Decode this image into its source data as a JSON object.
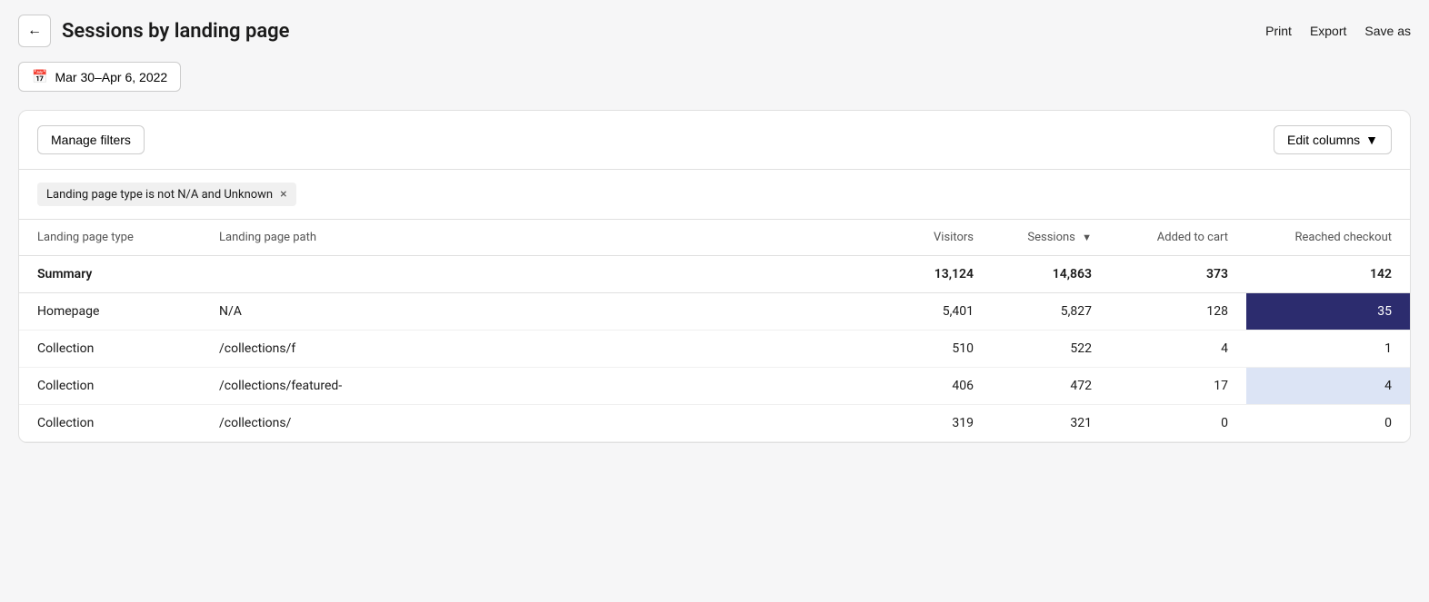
{
  "header": {
    "back_label": "←",
    "title": "Sessions by landing page",
    "actions": {
      "print": "Print",
      "export": "Export",
      "save_as": "Save as"
    }
  },
  "date_filter": {
    "label": "Mar 30–Apr 6, 2022"
  },
  "toolbar": {
    "manage_filters": "Manage filters",
    "edit_columns": "Edit columns"
  },
  "filter": {
    "tag": "Landing page type is not N/A and Unknown",
    "remove_label": "×"
  },
  "table": {
    "columns": [
      {
        "key": "landing_type",
        "label": "Landing page type",
        "numeric": false
      },
      {
        "key": "landing_path",
        "label": "Landing page path",
        "numeric": false
      },
      {
        "key": "visitors",
        "label": "Visitors",
        "numeric": true
      },
      {
        "key": "sessions",
        "label": "Sessions",
        "numeric": true,
        "sorted": true
      },
      {
        "key": "added_to_cart",
        "label": "Added to cart",
        "numeric": true
      },
      {
        "key": "reached_checkout",
        "label": "Reached checkout",
        "numeric": true
      }
    ],
    "summary": {
      "label": "Summary",
      "visitors": "13,124",
      "sessions": "14,863",
      "added_to_cart": "373",
      "reached_checkout": "142"
    },
    "rows": [
      {
        "landing_type": "Homepage",
        "landing_path": "N/A",
        "visitors": "5,401",
        "sessions": "5,827",
        "added_to_cart": "128",
        "reached_checkout": "35",
        "highlight": "dark"
      },
      {
        "landing_type": "Collection",
        "landing_path": "/collections/f",
        "visitors": "510",
        "sessions": "522",
        "added_to_cart": "4",
        "reached_checkout": "1",
        "highlight": "none"
      },
      {
        "landing_type": "Collection",
        "landing_path": "/collections/featured-",
        "visitors": "406",
        "sessions": "472",
        "added_to_cart": "17",
        "reached_checkout": "4",
        "highlight": "light"
      },
      {
        "landing_type": "Collection",
        "landing_path": "/collections/",
        "visitors": "319",
        "sessions": "321",
        "added_to_cart": "0",
        "reached_checkout": "0",
        "highlight": "none"
      }
    ]
  }
}
